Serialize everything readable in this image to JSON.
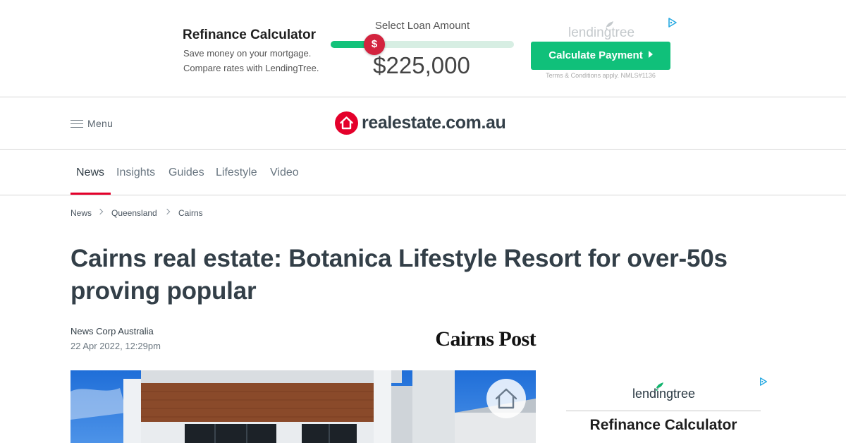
{
  "ad_top": {
    "title": "Refinance Calculator",
    "desc_line1": "Save money on your mortgage.",
    "desc_line2": "Compare rates with LendingTree.",
    "slider_label": "Select Loan Amount",
    "slider_symbol": "$",
    "slider_level_percent": 24,
    "loan_amount": "$225,000",
    "brand": "lendingtree",
    "button_label": "Calculate Payment",
    "terms": "Terms & Conditions apply. NMLS#1136"
  },
  "header": {
    "menu_label": "Menu",
    "logo_text": "realestate.com.au"
  },
  "section_nav": {
    "items": [
      {
        "label": "News",
        "active": true
      },
      {
        "label": "Insights",
        "active": false
      },
      {
        "label": "Guides",
        "active": false
      },
      {
        "label": "Lifestyle",
        "active": false
      },
      {
        "label": "Video",
        "active": false
      }
    ]
  },
  "breadcrumb": [
    "News",
    "Queensland",
    "Cairns"
  ],
  "article": {
    "headline_line1": "Cairns real estate: Botanica Lifestyle Resort for over-50s",
    "headline_line2": "proving popular",
    "author": "News Corp Australia",
    "date": "22 Apr 2022, 12:29pm",
    "masthead": "Cairns Post"
  },
  "ad_side": {
    "brand": "lendingtree",
    "title": "Refinance Calculator"
  },
  "colors": {
    "brand_red": "#e4002b",
    "text_dark": "#333f48",
    "lt_green": "#10c07a",
    "slider_thumb": "#d3233e"
  },
  "icons": [
    "menu-icon",
    "house-logo-icon",
    "chevron-right-icon",
    "save-home-icon",
    "adchoices-icon",
    "lendingtree-leaf-icon"
  ]
}
